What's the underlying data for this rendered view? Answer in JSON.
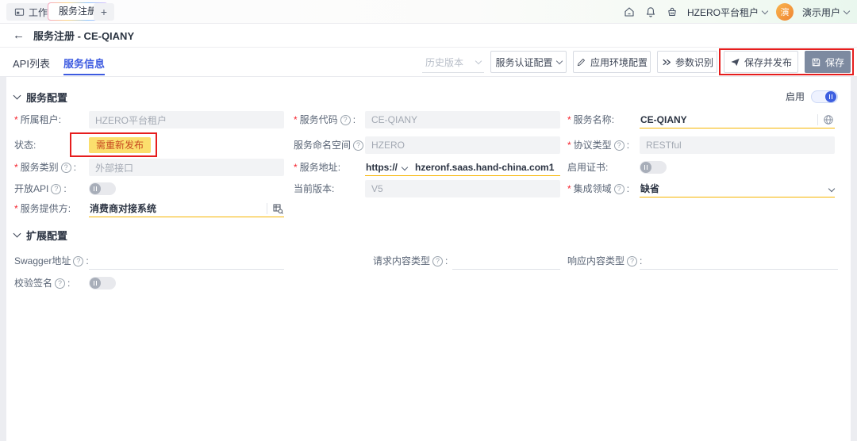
{
  "colors": {
    "accent": "#3d5be0",
    "amber_underline": "#f7b500",
    "annotation_red": "#e61d1d",
    "badge_bg": "#fbdf6d",
    "badge_text": "#c7491f",
    "save_button_bg": "#7d8aa0",
    "avatar_bg": "#f09a3e"
  },
  "marks": {
    "required": "*",
    "help": "?",
    "colon": ":"
  },
  "topbar": {
    "workbench_tab": "工作台",
    "active_tab": "服务注册",
    "new_tab": "+",
    "tenant": "HZERO平台租户",
    "avatar": "演",
    "user": "演示用户"
  },
  "breadcrumb": {
    "back": "←",
    "title": "服务注册 - CE-QIANY"
  },
  "tabs": {
    "api_list": "API列表",
    "service_info": "服务信息"
  },
  "toolbar": {
    "history": "历史版本",
    "auth_config": "服务认证配置",
    "env_config": "应用环境配置",
    "param_identify": "参数识别",
    "save_publish": "保存并发布",
    "save": "保存"
  },
  "sections": {
    "service_config": "服务配置",
    "extend_config": "扩展配置",
    "enable": "启用"
  },
  "fields": {
    "tenant": {
      "label": "所属租户",
      "value": "HZERO平台租户"
    },
    "service_code": {
      "label": "服务代码",
      "value": "CE-QIANY"
    },
    "service_name": {
      "label": "服务名称",
      "value": "CE-QIANY"
    },
    "status": {
      "label": "状态",
      "value": "需重新发布"
    },
    "namespace": {
      "label": "服务命名空间",
      "value": "HZERO"
    },
    "protocol": {
      "label": "协议类型",
      "value": "RESTful"
    },
    "category": {
      "label": "服务类别",
      "value": "外部接口"
    },
    "address": {
      "label": "服务地址",
      "protocol": "https://",
      "value": "hzeronf.saas.hand-china.com1"
    },
    "cert": {
      "label": "启用证书",
      "value": "off"
    },
    "open_api": {
      "label": "开放API",
      "value": "off"
    },
    "version": {
      "label": "当前版本",
      "value": "V5"
    },
    "domain": {
      "label": "集成领域",
      "value": "缺省"
    },
    "provider": {
      "label": "服务提供方",
      "value": "消费商对接系统"
    },
    "swagger": {
      "label": "Swagger地址",
      "value": ""
    },
    "request_type": {
      "label": "请求内容类型",
      "value": ""
    },
    "response_type": {
      "label": "响应内容类型",
      "value": ""
    },
    "verify_sign": {
      "label": "校验签名",
      "value": "off"
    }
  }
}
